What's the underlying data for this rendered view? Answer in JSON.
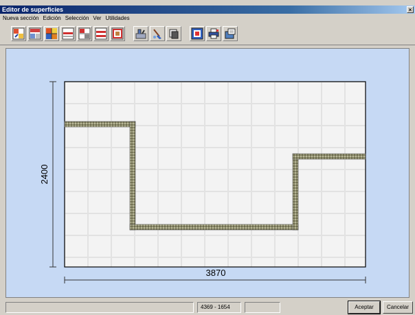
{
  "window": {
    "title": "Editor de superficies",
    "close_glyph": "×"
  },
  "menu": [
    {
      "label": "Nueva sección"
    },
    {
      "label": "Edición"
    },
    {
      "label": "Selección"
    },
    {
      "label": "Ver"
    },
    {
      "label": "Utilidades"
    }
  ],
  "toolbar": {
    "buttons": [
      {
        "icon": "tile-layout-icon-1"
      },
      {
        "icon": "tile-layout-icon-2"
      },
      {
        "icon": "tile-grid-icon"
      },
      {
        "icon": "tile-layout-icon-3"
      },
      {
        "icon": "tile-layout-icon-4"
      },
      {
        "icon": "tile-layout-icon-5"
      },
      {
        "icon": "tile-layout-icon-6"
      },
      {
        "icon": "tools-icon"
      },
      {
        "icon": "cleaning-icon"
      },
      {
        "icon": "copy-icon"
      },
      {
        "icon": "surface-icon"
      },
      {
        "icon": "print-icon"
      },
      {
        "icon": "export-icon"
      }
    ]
  },
  "drawing": {
    "width_dimension": "3870",
    "height_dimension": "2400",
    "background_color": "#c6d9f4",
    "tile_color": "#f3f3f3",
    "border_color": "#8a8a6e"
  },
  "statusbar": {
    "coords": "4369 - 1654",
    "accept_label": "Aceptar",
    "cancel_label": "Cancelar"
  }
}
